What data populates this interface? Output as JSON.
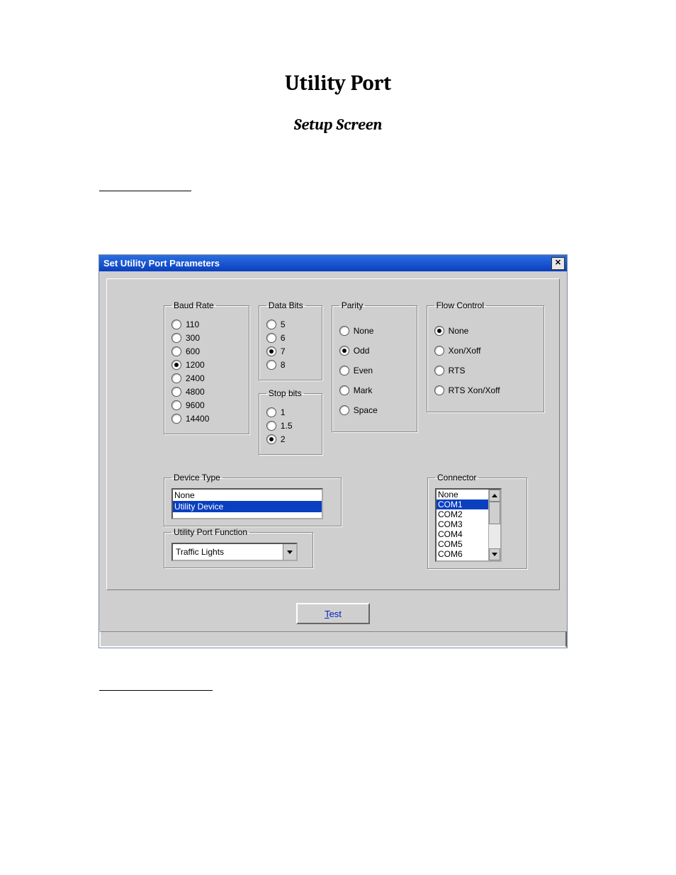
{
  "doc": {
    "title": "Utility Port",
    "subtitle": "Setup Screen"
  },
  "dialog": {
    "title": "Set Utility Port Parameters",
    "groups": {
      "baud": {
        "legend": "Baud Rate",
        "options": [
          "110",
          "300",
          "600",
          "1200",
          "2400",
          "4800",
          "9600",
          "14400"
        ],
        "selected": "1200"
      },
      "data_bits": {
        "legend": "Data Bits",
        "options": [
          "5",
          "6",
          "7",
          "8"
        ],
        "selected": "7"
      },
      "stop_bits": {
        "legend": "Stop bits",
        "options": [
          "1",
          "1.5",
          "2"
        ],
        "selected": "2"
      },
      "parity": {
        "legend": "Parity",
        "options": [
          "None",
          "Odd",
          "Even",
          "Mark",
          "Space"
        ],
        "selected": "Odd"
      },
      "flow": {
        "legend": "Flow Control",
        "options": [
          "None",
          "Xon/Xoff",
          "RTS",
          "RTS Xon/Xoff"
        ],
        "selected": "None"
      },
      "device_type": {
        "legend": "Device Type",
        "options": [
          "None",
          "Utility Device"
        ],
        "selected": "Utility Device"
      },
      "utility_port_function": {
        "legend": "Utility Port Function",
        "value": "Traffic Lights"
      },
      "connector": {
        "legend": "Connector",
        "options": [
          "None",
          "COM1",
          "COM2",
          "COM3",
          "COM4",
          "COM5",
          "COM6"
        ],
        "selected": "COM1"
      }
    },
    "buttons": {
      "test": "Test"
    }
  }
}
